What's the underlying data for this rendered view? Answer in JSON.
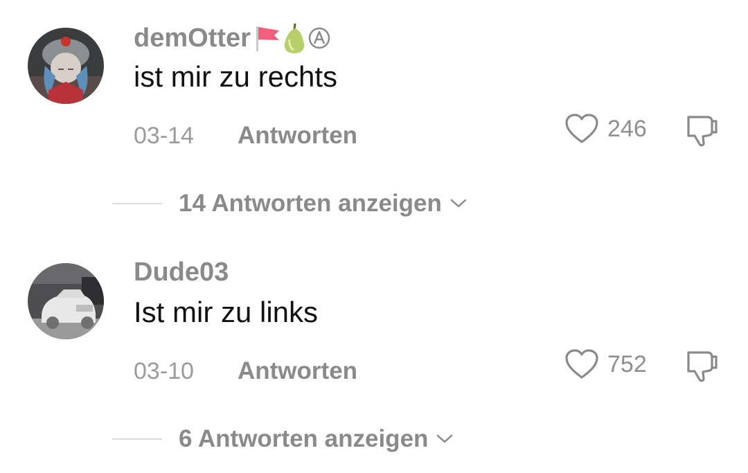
{
  "comments": [
    {
      "username": "demOtter",
      "badges": [
        "red-flag-icon",
        "pear-icon",
        "circled-a-icon"
      ],
      "text": "ist mir zu rechts",
      "date": "03-14",
      "reply_label": "Antworten",
      "like_count": "246",
      "view_replies_label": "14 Antworten anzeigen"
    },
    {
      "username": "Dude03",
      "badges": [],
      "text": "Ist mir zu links",
      "date": "03-10",
      "reply_label": "Antworten",
      "like_count": "752",
      "view_replies_label": "6 Antworten anzeigen"
    }
  ],
  "colors": {
    "username": "#8a8a8a",
    "text": "#111111",
    "meta": "#9b9b9b",
    "icon": "#8a8a8a",
    "flag": "#f0607a",
    "pear": "#b6cf6a"
  }
}
